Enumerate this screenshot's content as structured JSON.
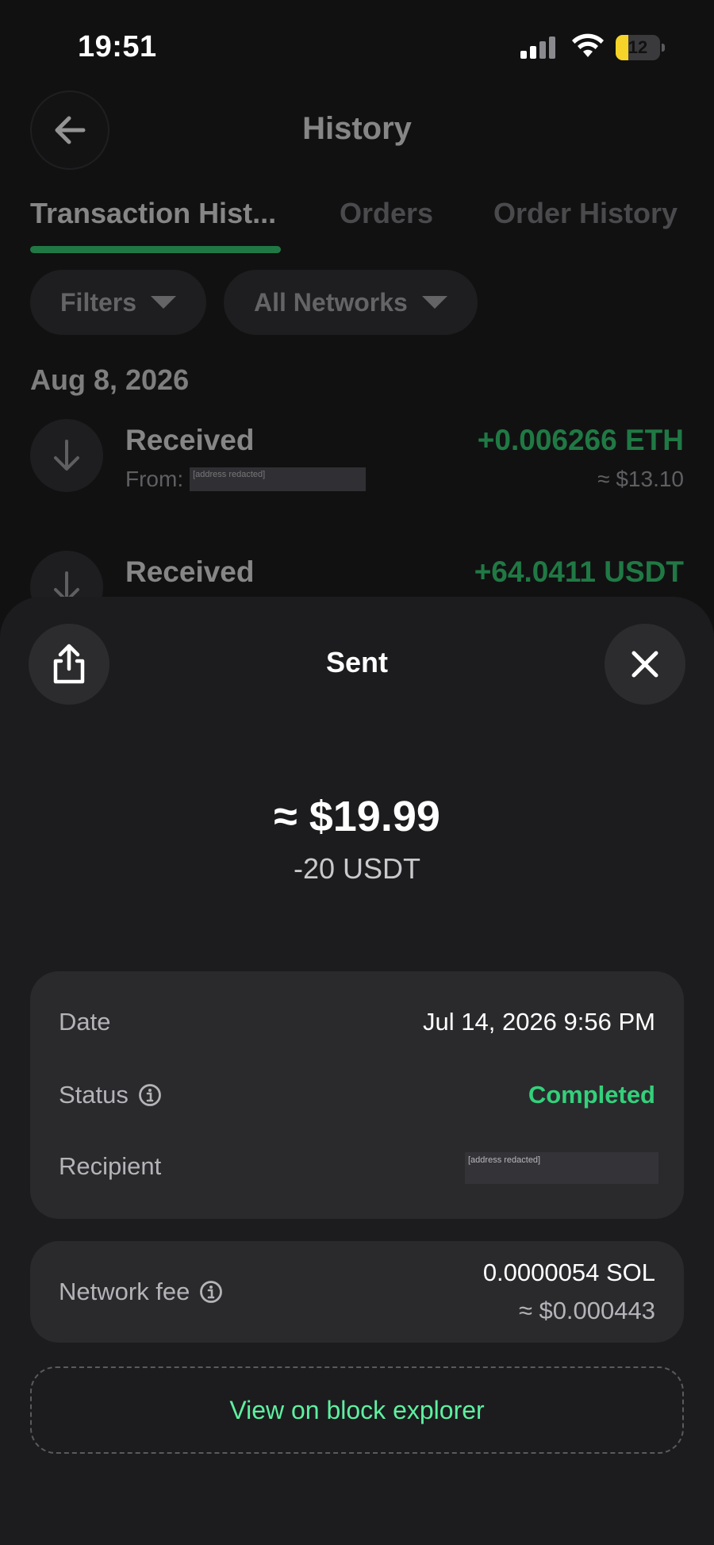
{
  "status_bar": {
    "time": "19:51",
    "battery": "12",
    "battery_level": 0.12
  },
  "header": {
    "title": "History",
    "back_icon": "arrow-left-icon"
  },
  "tabs": [
    {
      "label": "Transaction Hist...",
      "active": true
    },
    {
      "label": "Orders",
      "active": false
    },
    {
      "label": "Order History",
      "active": false
    }
  ],
  "filters": {
    "filters_label": "Filters",
    "networks_label": "All Networks"
  },
  "history": {
    "date_heading": "Aug 8, 2026",
    "transactions": [
      {
        "title": "Received",
        "from_label": "From:",
        "from_address": "[address redacted]",
        "amount": "+0.006266 ETH",
        "usd": "≈ $13.10"
      },
      {
        "title": "Received",
        "amount": "+64.0411 USDT"
      }
    ]
  },
  "sheet": {
    "title": "Sent",
    "share_icon": "share-icon",
    "close_icon": "close-icon",
    "amount_usd": "≈ $19.99",
    "amount_token": "-20 USDT",
    "details": {
      "date_label": "Date",
      "date_value": "Jul 14, 2026 9:56 PM",
      "status_label": "Status",
      "status_value": "Completed",
      "recipient_label": "Recipient",
      "recipient_value": "[address redacted]"
    },
    "fee": {
      "label": "Network fee",
      "value": "0.0000054 SOL",
      "usd": "≈ $0.000443"
    },
    "explorer_label": "View on block explorer"
  },
  "colors": {
    "accent_green": "#2ecf6e",
    "status_green": "#33d17a",
    "link_green": "#5ef0a0",
    "battery_yellow": "#f5d328"
  }
}
